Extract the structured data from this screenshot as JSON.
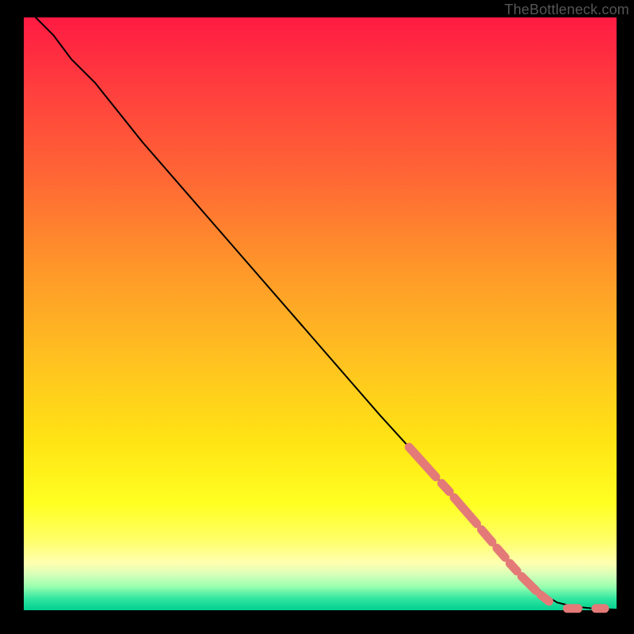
{
  "watermark": "TheBottleneck.com",
  "colors": {
    "dash": "#e37a78",
    "curve": "#000000",
    "frame_bg": "#000000"
  },
  "chart_data": {
    "type": "line",
    "title": "",
    "xlabel": "",
    "ylabel": "",
    "xlim": [
      0,
      100
    ],
    "ylim": [
      0,
      100
    ],
    "grid": false,
    "legend": false,
    "series": [
      {
        "name": "bottleneck-curve",
        "x": [
          2,
          5,
          8,
          12,
          20,
          30,
          40,
          50,
          60,
          65,
          70,
          75,
          80,
          84,
          88,
          90,
          92,
          94,
          96,
          98,
          100
        ],
        "y": [
          100,
          97,
          93,
          89,
          79,
          67.5,
          56,
          44.5,
          33,
          27.5,
          22,
          16,
          10,
          6,
          2.5,
          1.3,
          0.8,
          0.5,
          0.3,
          0.2,
          0.1
        ]
      }
    ],
    "marker_segments": [
      {
        "x0": 65.0,
        "y0": 27.5,
        "x1": 69.5,
        "y1": 22.5
      },
      {
        "x0": 70.5,
        "y0": 21.4,
        "x1": 71.8,
        "y1": 20.0
      },
      {
        "x0": 72.6,
        "y0": 19.0,
        "x1": 76.4,
        "y1": 14.6
      },
      {
        "x0": 77.2,
        "y0": 13.6,
        "x1": 79.0,
        "y1": 11.5
      },
      {
        "x0": 79.8,
        "y0": 10.5,
        "x1": 81.2,
        "y1": 8.9
      },
      {
        "x0": 82.0,
        "y0": 7.9,
        "x1": 83.2,
        "y1": 6.6
      },
      {
        "x0": 84.0,
        "y0": 5.7,
        "x1": 86.4,
        "y1": 3.3
      },
      {
        "x0": 87.2,
        "y0": 2.6,
        "x1": 88.6,
        "y1": 1.5
      },
      {
        "x0": 91.7,
        "y0": 0.3,
        "x1": 93.5,
        "y1": 0.3
      },
      {
        "x0": 96.5,
        "y0": 0.3,
        "x1": 98.0,
        "y1": 0.3
      }
    ]
  }
}
